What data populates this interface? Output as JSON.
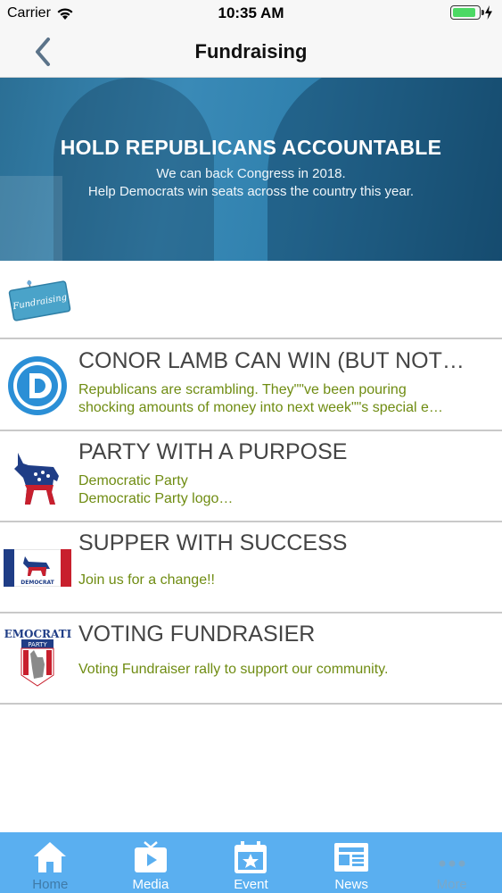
{
  "status_bar": {
    "carrier": "Carrier",
    "time": "10:35 AM",
    "battery_level": 0.9
  },
  "nav": {
    "title": "Fundraising",
    "back_icon": "chevron-left-icon"
  },
  "banner": {
    "headline": "HOLD REPUBLICANS ACCOUNTABLE",
    "line1": "We can back Congress in 2018.",
    "line2": "Help Democrats win seats across the country this year."
  },
  "category": {
    "sign_text": "Fundraising"
  },
  "items": [
    {
      "title": "CONOR LAMB CAN WIN (BUT NOT…",
      "desc1": "Republicans are scrambling. They\"\"ve been pouring",
      "desc2": "shocking amounts of money into next week\"\"s special e…"
    },
    {
      "title": "PARTY WITH A PURPOSE",
      "desc1": "Democratic Party",
      "desc2": "Democratic Party logo…"
    },
    {
      "title": "SUPPER WITH SUCCESS",
      "desc1": "Join us for a change!!",
      "thumb_label": "DEMOCRAT"
    },
    {
      "title": "VOTING FUNDRASIER",
      "desc1": "Voting Fundraiser rally to support our community.",
      "thumb_label_top": "DEMOCRATIC",
      "thumb_label_mid": "PARTY"
    }
  ],
  "tabs": [
    {
      "label": "Home",
      "icon": "home-icon"
    },
    {
      "label": "Media",
      "icon": "tv-play-icon"
    },
    {
      "label": "Event",
      "icon": "calendar-star-icon"
    },
    {
      "label": "News",
      "icon": "newspaper-icon"
    },
    {
      "label": "More",
      "icon": "more-dots-icon"
    }
  ],
  "colors": {
    "accent_green": "#6f8c12",
    "tab_bar": "#5aaff0",
    "banner_blue": "#3a8ab7"
  }
}
